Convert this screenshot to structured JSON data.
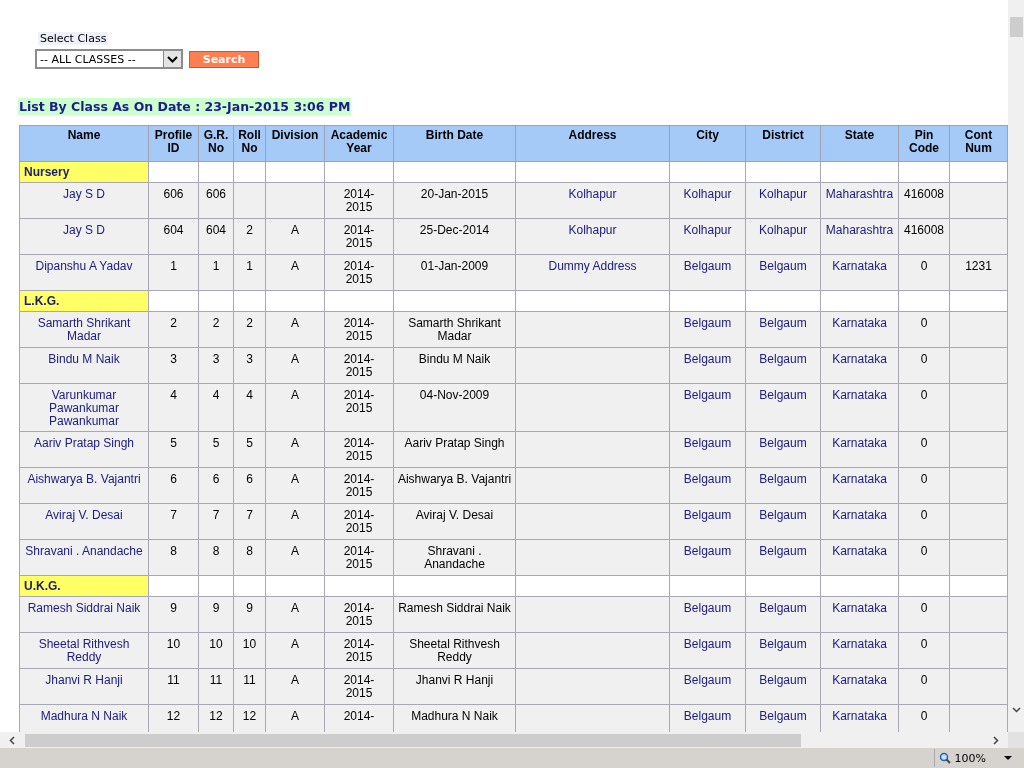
{
  "filter": {
    "label": "Select Class",
    "select_value": "-- ALL CLASSES --",
    "button": "Search"
  },
  "list_title": "List By Class As On Date : 23-Jan-2015 3:06 PM",
  "table": {
    "columns": [
      "Name",
      "Profile ID",
      "G.R. No",
      "Roll No",
      "Division",
      "Academic Year",
      "Birth Date",
      "Address",
      "City",
      "District",
      "State",
      "Pin Code",
      "Cont Num"
    ],
    "groups": [
      {
        "label": "Nursery",
        "rows": [
          {
            "name": "Jay S D",
            "profile_id": "606",
            "gr_no": "606",
            "academic_year": "2014-2015",
            "birth_date": "20-Jan-2015",
            "address": "Kolhapur",
            "city": "Kolhapur",
            "district": "Kolhapur",
            "state": "Maharashtra",
            "pin_code": "416008"
          },
          {
            "name": "Jay S D",
            "profile_id": "604",
            "gr_no": "604",
            "roll_no": "2",
            "division": "A",
            "academic_year": "2014-2015",
            "birth_date": "25-Dec-2014",
            "address": "Kolhapur",
            "city": "Kolhapur",
            "district": "Kolhapur",
            "state": "Maharashtra",
            "pin_code": "416008"
          },
          {
            "name": "Dipanshu A Yadav",
            "profile_id": "1",
            "gr_no": "1",
            "roll_no": "1",
            "division": "A",
            "academic_year": "2014-2015",
            "birth_date": "01-Jan-2009",
            "address": "Dummy Address",
            "city": "Belgaum",
            "district": "Belgaum",
            "state": "Karnataka",
            "pin_code": "0",
            "contact": "1231"
          }
        ]
      },
      {
        "label": "L.K.G.",
        "rows": [
          {
            "name": "Samarth Shrikant Madar",
            "profile_id": "2",
            "gr_no": "2",
            "roll_no": "2",
            "division": "A",
            "academic_year": "2014-2015",
            "birth_date": "Samarth Shrikant Madar",
            "city": "Belgaum",
            "district": "Belgaum",
            "state": "Karnataka",
            "pin_code": "0"
          },
          {
            "name": "Bindu M Naik",
            "profile_id": "3",
            "gr_no": "3",
            "roll_no": "3",
            "division": "A",
            "academic_year": "2014-2015",
            "birth_date": "Bindu M Naik",
            "city": "Belgaum",
            "district": "Belgaum",
            "state": "Karnataka",
            "pin_code": "0"
          },
          {
            "name": "Varunkumar Pawankumar Pawankumar",
            "profile_id": "4",
            "gr_no": "4",
            "roll_no": "4",
            "division": "A",
            "academic_year": "2014-2015",
            "birth_date": "04-Nov-2009",
            "city": "Belgaum",
            "district": "Belgaum",
            "state": "Karnataka",
            "pin_code": "0"
          },
          {
            "name": "Aariv Pratap Singh",
            "profile_id": "5",
            "gr_no": "5",
            "roll_no": "5",
            "division": "A",
            "academic_year": "2014-2015",
            "birth_date": "Aariv Pratap Singh",
            "city": "Belgaum",
            "district": "Belgaum",
            "state": "Karnataka",
            "pin_code": "0"
          },
          {
            "name": "Aishwarya B. Vajantri",
            "profile_id": "6",
            "gr_no": "6",
            "roll_no": "6",
            "division": "A",
            "academic_year": "2014-2015",
            "birth_date": "Aishwarya B. Vajantri",
            "city": "Belgaum",
            "district": "Belgaum",
            "state": "Karnataka",
            "pin_code": "0"
          },
          {
            "name": "Aviraj V. Desai",
            "profile_id": "7",
            "gr_no": "7",
            "roll_no": "7",
            "division": "A",
            "academic_year": "2014-2015",
            "birth_date": "Aviraj V. Desai",
            "city": "Belgaum",
            "district": "Belgaum",
            "state": "Karnataka",
            "pin_code": "0"
          },
          {
            "name": "Shravani . Anandache",
            "profile_id": "8",
            "gr_no": "8",
            "roll_no": "8",
            "division": "A",
            "academic_year": "2014-2015",
            "birth_date": "Shravani . Anandache",
            "city": "Belgaum",
            "district": "Belgaum",
            "state": "Karnataka",
            "pin_code": "0"
          }
        ]
      },
      {
        "label": "U.K.G.",
        "rows": [
          {
            "name": "Ramesh Siddrai Naik",
            "profile_id": "9",
            "gr_no": "9",
            "roll_no": "9",
            "division": "A",
            "academic_year": "2014-2015",
            "birth_date": "Ramesh Siddrai Naik",
            "city": "Belgaum",
            "district": "Belgaum",
            "state": "Karnataka",
            "pin_code": "0"
          },
          {
            "name": "Sheetal Rithvesh Reddy",
            "profile_id": "10",
            "gr_no": "10",
            "roll_no": "10",
            "division": "A",
            "academic_year": "2014-2015",
            "birth_date": "Sheetal Rithvesh Reddy",
            "city": "Belgaum",
            "district": "Belgaum",
            "state": "Karnataka",
            "pin_code": "0"
          },
          {
            "name": "Jhanvi R Hanji",
            "profile_id": "11",
            "gr_no": "11",
            "roll_no": "11",
            "division": "A",
            "academic_year": "2014-2015",
            "birth_date": "Jhanvi R Hanji",
            "city": "Belgaum",
            "district": "Belgaum",
            "state": "Karnataka",
            "pin_code": "0"
          },
          {
            "name": "Madhura N Naik",
            "profile_id": "12",
            "gr_no": "12",
            "roll_no": "12",
            "division": "A",
            "academic_year": "2014-",
            "birth_date": "Madhura N Naik",
            "city": "Belgaum",
            "district": "Belgaum",
            "state": "Karnataka",
            "pin_code": "0"
          }
        ]
      }
    ]
  },
  "status_bar": {
    "zoom": "100%"
  }
}
